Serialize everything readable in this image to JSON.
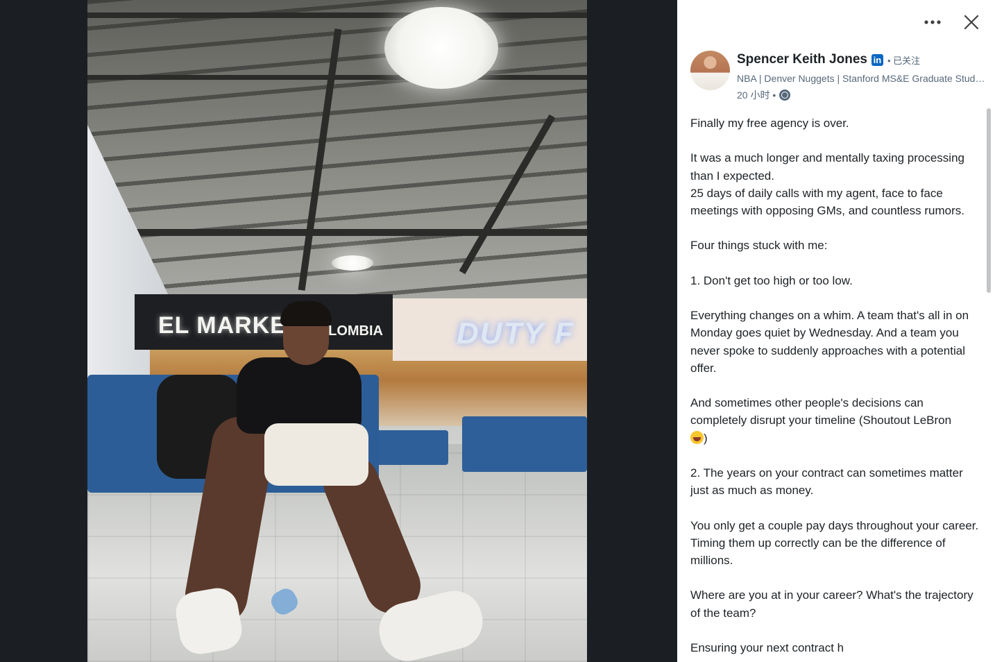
{
  "photo": {
    "alt_text": "",
    "signs": {
      "left_main": "EL MARKE",
      "left_sub": "OLOMBIA",
      "right_main": "DUTY F"
    }
  },
  "toolbar": {
    "more_icon": "more-horizontal-icon",
    "close_icon": "close-icon"
  },
  "author": {
    "name": "Spencer Keith Jones",
    "badge": "in",
    "follow_status": "• 已关注",
    "headline": "NBA | Denver Nuggets | Stanford MS&E Graduate Student | Investor",
    "time": "20 小时 •",
    "visibility_icon": "globe-icon"
  },
  "post": {
    "paragraphs": [
      "Finally my free agency is over.",
      "It was a much longer and mentally taxing processing than I expected.\n25 days of daily calls with my agent, face to face meetings with opposing GMs, and countless rumors.",
      "Four things stuck with me:",
      "1. Don't get too high or too low.",
      "Everything changes on a whim. A team that's all in on Monday goes quiet by Wednesday. And a team you never spoke to suddenly approaches with a potential offer.",
      "And sometimes other people's decisions can completely disrupt your timeline (Shoutout LeBron",
      "2. The years on your contract can sometimes matter just as much as money.",
      "You only get a couple pay days throughout your career. Timing them up correctly can be the difference of millions.",
      "Where are you at in your career? What's the trajectory of the team?",
      "Ensuring your next contract h"
    ],
    "emoji_close": ")",
    "emoji_icon": "laughing-emoji-icon"
  },
  "colors": {
    "background": "#1b1f23",
    "panel": "#ffffff",
    "text": "#1d2226",
    "muted": "#56687a",
    "linkedin_blue": "#0a66c2"
  }
}
